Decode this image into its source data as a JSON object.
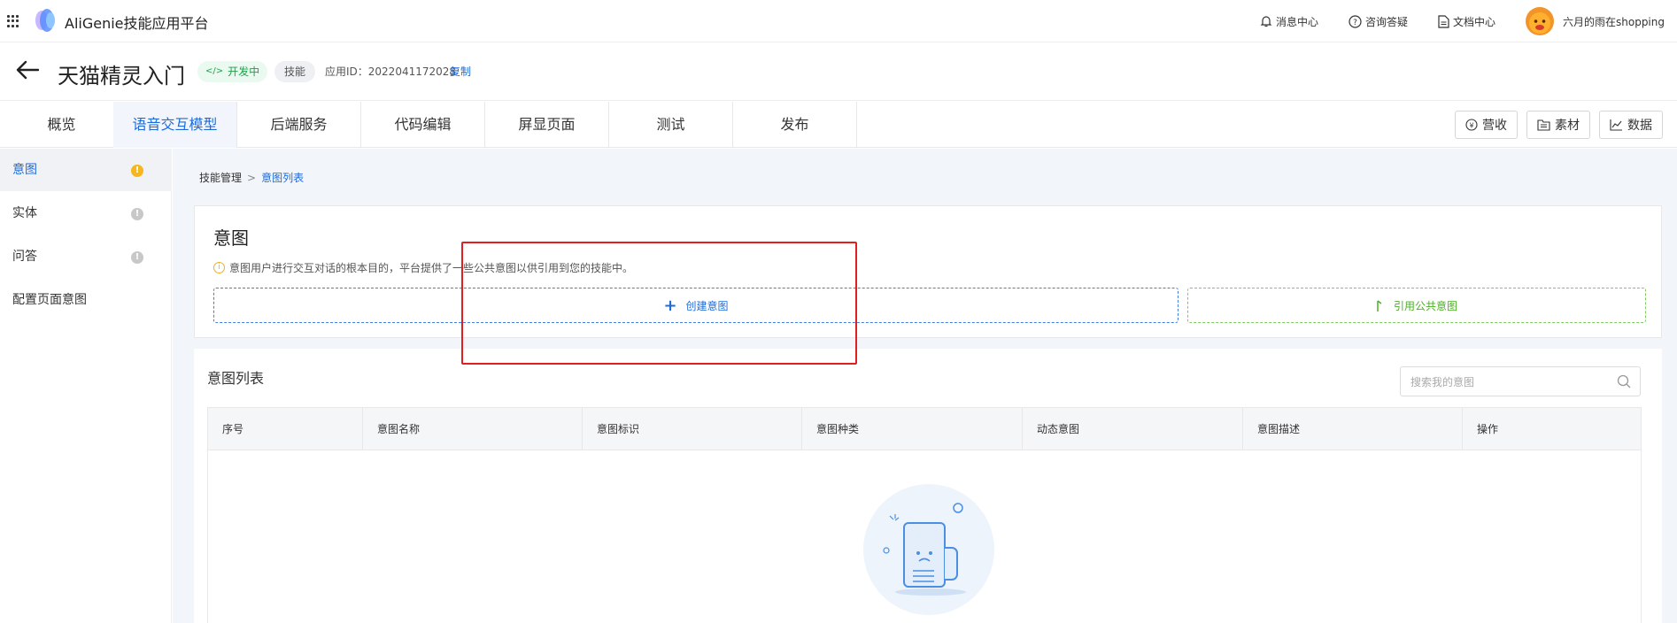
{
  "app": {
    "title": "AliGenie技能应用平台"
  },
  "header_links": [
    {
      "label": "消息中心",
      "icon": "bell-icon"
    },
    {
      "label": "咨询答疑",
      "icon": "help-icon"
    },
    {
      "label": "文档中心",
      "icon": "document-icon"
    }
  ],
  "user": {
    "name": "六月的雨在shopping"
  },
  "skill": {
    "name": "天猫精灵入门",
    "status": "开发中",
    "type": "技能",
    "app_id_label": "应用ID：",
    "app_id": "2022041172028",
    "copy_label": "复制"
  },
  "tabs": [
    {
      "label": "概览",
      "active": false
    },
    {
      "label": "语音交互模型",
      "active": true
    },
    {
      "label": "后端服务",
      "active": false
    },
    {
      "label": "代码编辑",
      "active": false
    },
    {
      "label": "屏显页面",
      "active": false
    },
    {
      "label": "测试",
      "active": false
    },
    {
      "label": "发布",
      "active": false
    }
  ],
  "tools": [
    {
      "label": "营收",
      "icon": "revenue-icon"
    },
    {
      "label": "素材",
      "icon": "material-icon"
    },
    {
      "label": "数据",
      "icon": "chart-line-icon"
    }
  ],
  "sidebar": {
    "items": [
      {
        "label": "意图",
        "badge": "!",
        "badge_color": "#f5b71b",
        "active": true
      },
      {
        "label": "实体",
        "badge": "!",
        "badge_color": "#c8c8c8",
        "active": false
      },
      {
        "label": "问答",
        "badge": "!",
        "badge_color": "#c8c8c8",
        "active": false
      },
      {
        "label": "配置页面意图",
        "badge": "",
        "badge_color": "",
        "active": false
      }
    ]
  },
  "breadcrumb": {
    "parent": "技能管理",
    "separator": ">",
    "current": "意图列表"
  },
  "intent_card": {
    "title": "意图",
    "hint": "意图用户进行交互对话的根本目的，平台提供了一些公共意图以供引用到您的技能中。",
    "create_label": "创建意图",
    "reference_label": "引用公共意图"
  },
  "intent_list": {
    "title": "意图列表",
    "search_placeholder": "搜索我的意图",
    "columns": [
      "序号",
      "意图名称",
      "意图标识",
      "意图种类",
      "动态意图",
      "意图描述",
      "操作"
    ]
  },
  "colors": {
    "accent": "#1f6bd6",
    "success": "#4caf26",
    "highlight": "#e02020"
  }
}
